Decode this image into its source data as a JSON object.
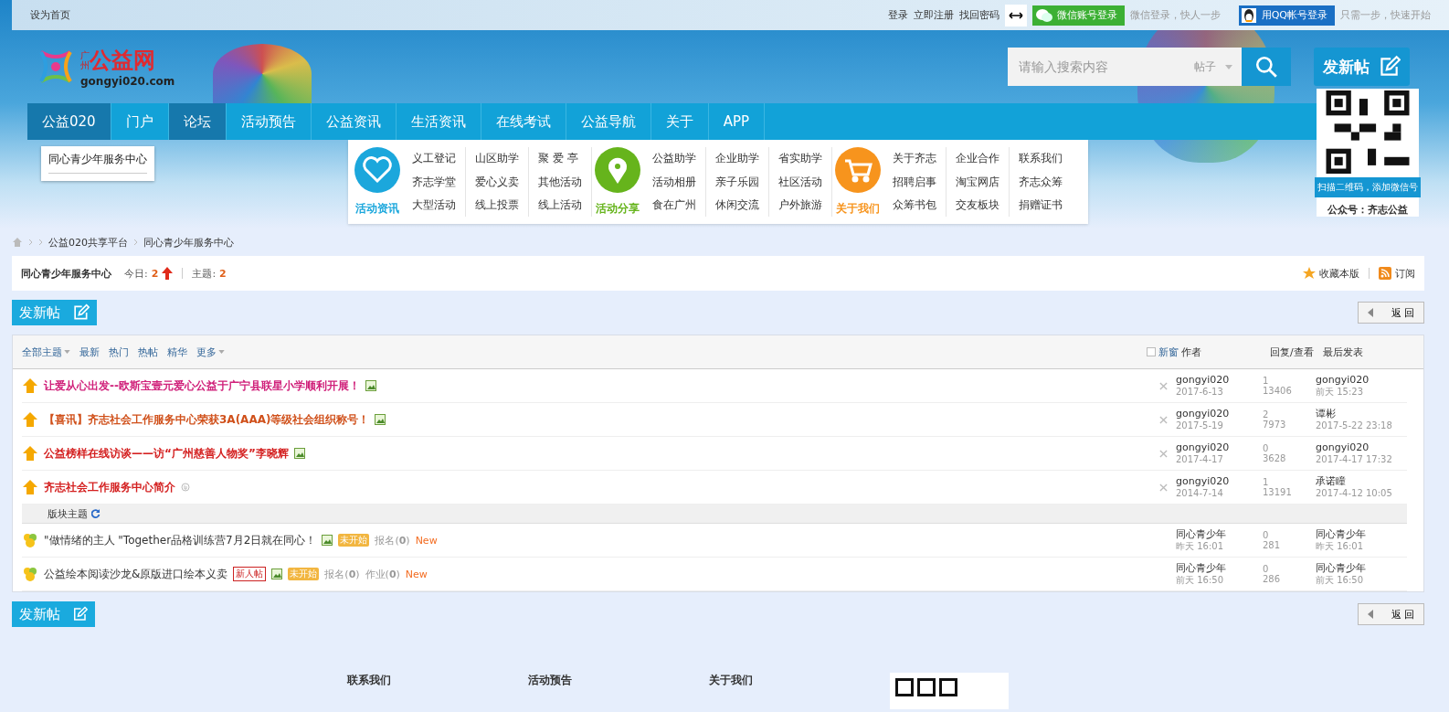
{
  "top_bar": {
    "home_link": "设为首页",
    "links": [
      "登录",
      "立即注册",
      "找回密码"
    ],
    "wechat_button": "微信账号登录",
    "wechat_hint": "微信登录，快人一步",
    "qq_button": "用QQ帐号登录",
    "qq_hint": "只需一步，快速开始"
  },
  "header": {
    "logo_city": "广州",
    "logo_name": "公益网",
    "logo_url": "gongyi020.com",
    "search_placeholder": "请输入搜索内容",
    "search_type": "帖子",
    "new_post": "发新帖",
    "qr_caption": "扫描二维码，添加微信号",
    "qr_account": "公众号：齐志公益"
  },
  "nav": [
    {
      "label": "公益020",
      "selected": true
    },
    {
      "label": "门户",
      "selected": false
    },
    {
      "label": "论坛",
      "selected": true
    },
    {
      "label": "活动预告",
      "selected": false
    },
    {
      "label": "公益资讯",
      "selected": false
    },
    {
      "label": "生活资讯",
      "selected": false
    },
    {
      "label": "在线考试",
      "selected": false
    },
    {
      "label": "公益导航",
      "selected": false
    },
    {
      "label": "关于",
      "selected": false
    },
    {
      "label": "APP",
      "selected": false
    }
  ],
  "nav_dropdown": [
    "同心青少年服务中心"
  ],
  "mega_menu": [
    {
      "title": "活动资讯",
      "kind": "heart",
      "color": "#1ba7dc",
      "columns": [
        [
          "义工登记",
          "齐志学堂",
          "大型活动"
        ],
        [
          "山区助学",
          "爱心义卖",
          "线上投票"
        ],
        [
          "聚 爱 亭",
          "其他活动",
          "线上活动"
        ]
      ]
    },
    {
      "title": "活动分享",
      "kind": "pin",
      "color": "#66b41c",
      "columns": [
        [
          "公益助学",
          "活动相册",
          "食在广州"
        ],
        [
          "企业助学",
          "亲子乐园",
          "休闲交流"
        ],
        [
          "省实助学",
          "社区活动",
          "户外旅游"
        ]
      ]
    },
    {
      "title": "关于我们",
      "kind": "cart",
      "color": "#f7941d",
      "columns": [
        [
          "关于齐志",
          "招聘启事",
          "众筹书包"
        ],
        [
          "企业合作",
          "淘宝网店",
          "交友板块"
        ],
        [
          "联系我们",
          "齐志众筹",
          "捐赠证书"
        ]
      ]
    }
  ],
  "breadcrumb": [
    "公益020共享平台",
    "同心青少年服务中心"
  ],
  "forum": {
    "name": "同心青少年服务中心",
    "today_label": "今日:",
    "today": "2",
    "topics_label": "主题:",
    "topics": "2",
    "favorite": "收藏本版",
    "subscribe": "订阅"
  },
  "action_bars": [
    {
      "new_post": "发新帖",
      "back": "返 回"
    },
    {
      "new_post": "发新帖",
      "back": "返 回"
    }
  ],
  "filters": [
    {
      "label": "全部主题",
      "dropdown": true
    },
    {
      "label": "最新",
      "dropdown": false
    },
    {
      "label": "热门",
      "dropdown": false
    },
    {
      "label": "热帖",
      "dropdown": false
    },
    {
      "label": "精华",
      "dropdown": false
    },
    {
      "label": "更多",
      "dropdown": true
    }
  ],
  "table": {
    "new_window": {
      "label": "新窗",
      "checked": false
    },
    "columns": [
      "作者",
      "回复/查看",
      "最后发表"
    ],
    "section_label": "版块主题"
  },
  "threads": [
    {
      "kind": "sticky",
      "title": "让爱从心出发--欧斯宝壹元爱心公益于广宁县联星小学顺利开展！",
      "color": "#d0207a",
      "badges": [
        {
          "kind": "image"
        }
      ],
      "author": "gongyi020",
      "date": "2017-6-13",
      "replies": "1",
      "views": "13406",
      "last_user": "gongyi020",
      "last_time": "前天 15:23"
    },
    {
      "kind": "sticky",
      "title": "【喜讯】齐志社会工作服务中心荣获3A(AAA)等级社会组织称号！",
      "color": "#d0501a",
      "badges": [
        {
          "kind": "image"
        }
      ],
      "author": "gongyi020",
      "date": "2017-5-19",
      "replies": "2",
      "views": "7973",
      "last_user": "谭彬",
      "last_time": "2017-5-22 23:18"
    },
    {
      "kind": "sticky",
      "title": "公益榜样在线访谈——访“广州慈善人物奖”李晓辉",
      "color": "#d42020",
      "badges": [
        {
          "kind": "image"
        }
      ],
      "author": "gongyi020",
      "date": "2017-4-17",
      "replies": "0",
      "views": "3628",
      "last_user": "gongyi020",
      "last_time": "2017-4-17 17:32"
    },
    {
      "kind": "sticky",
      "title": "齐志社会工作服务中心简介",
      "color": "#d42020",
      "badges": [
        {
          "kind": "attach"
        }
      ],
      "author": "gongyi020",
      "date": "2014-7-14",
      "replies": "1",
      "views": "13191",
      "last_user": "承诺瞳",
      "last_time": "2017-4-12 10:05"
    },
    {
      "kind": "normal",
      "title": "\"做情绪的主人 \"Together品格训练营7月2日就在同心！",
      "color": "#333333",
      "badges": [
        {
          "kind": "image"
        },
        {
          "kind": "status",
          "text": "未开始"
        },
        {
          "kind": "count",
          "text": "报名(**0**)"
        },
        {
          "kind": "new",
          "text": "New"
        }
      ],
      "author": "同心青少年",
      "date": "昨天 16:01",
      "replies": "0",
      "views": "281",
      "last_user": "同心青少年",
      "last_time": "昨天 16:01"
    },
    {
      "kind": "normal",
      "title": "公益绘本阅读沙龙&原版进口绘本义卖",
      "color": "#333333",
      "badges": [
        {
          "kind": "newbie",
          "text": "新人帖"
        },
        {
          "kind": "image"
        },
        {
          "kind": "status",
          "text": "未开始"
        },
        {
          "kind": "count",
          "text": "报名(**0**)"
        },
        {
          "kind": "count",
          "text": "作业(**0**)"
        },
        {
          "kind": "new",
          "text": "New"
        }
      ],
      "author": "同心青少年",
      "date": "前天 16:50",
      "replies": "0",
      "views": "286",
      "last_user": "同心青少年",
      "last_time": "前天 16:50"
    }
  ],
  "footer": [
    "联系我们",
    "活动预告",
    "关于我们"
  ]
}
